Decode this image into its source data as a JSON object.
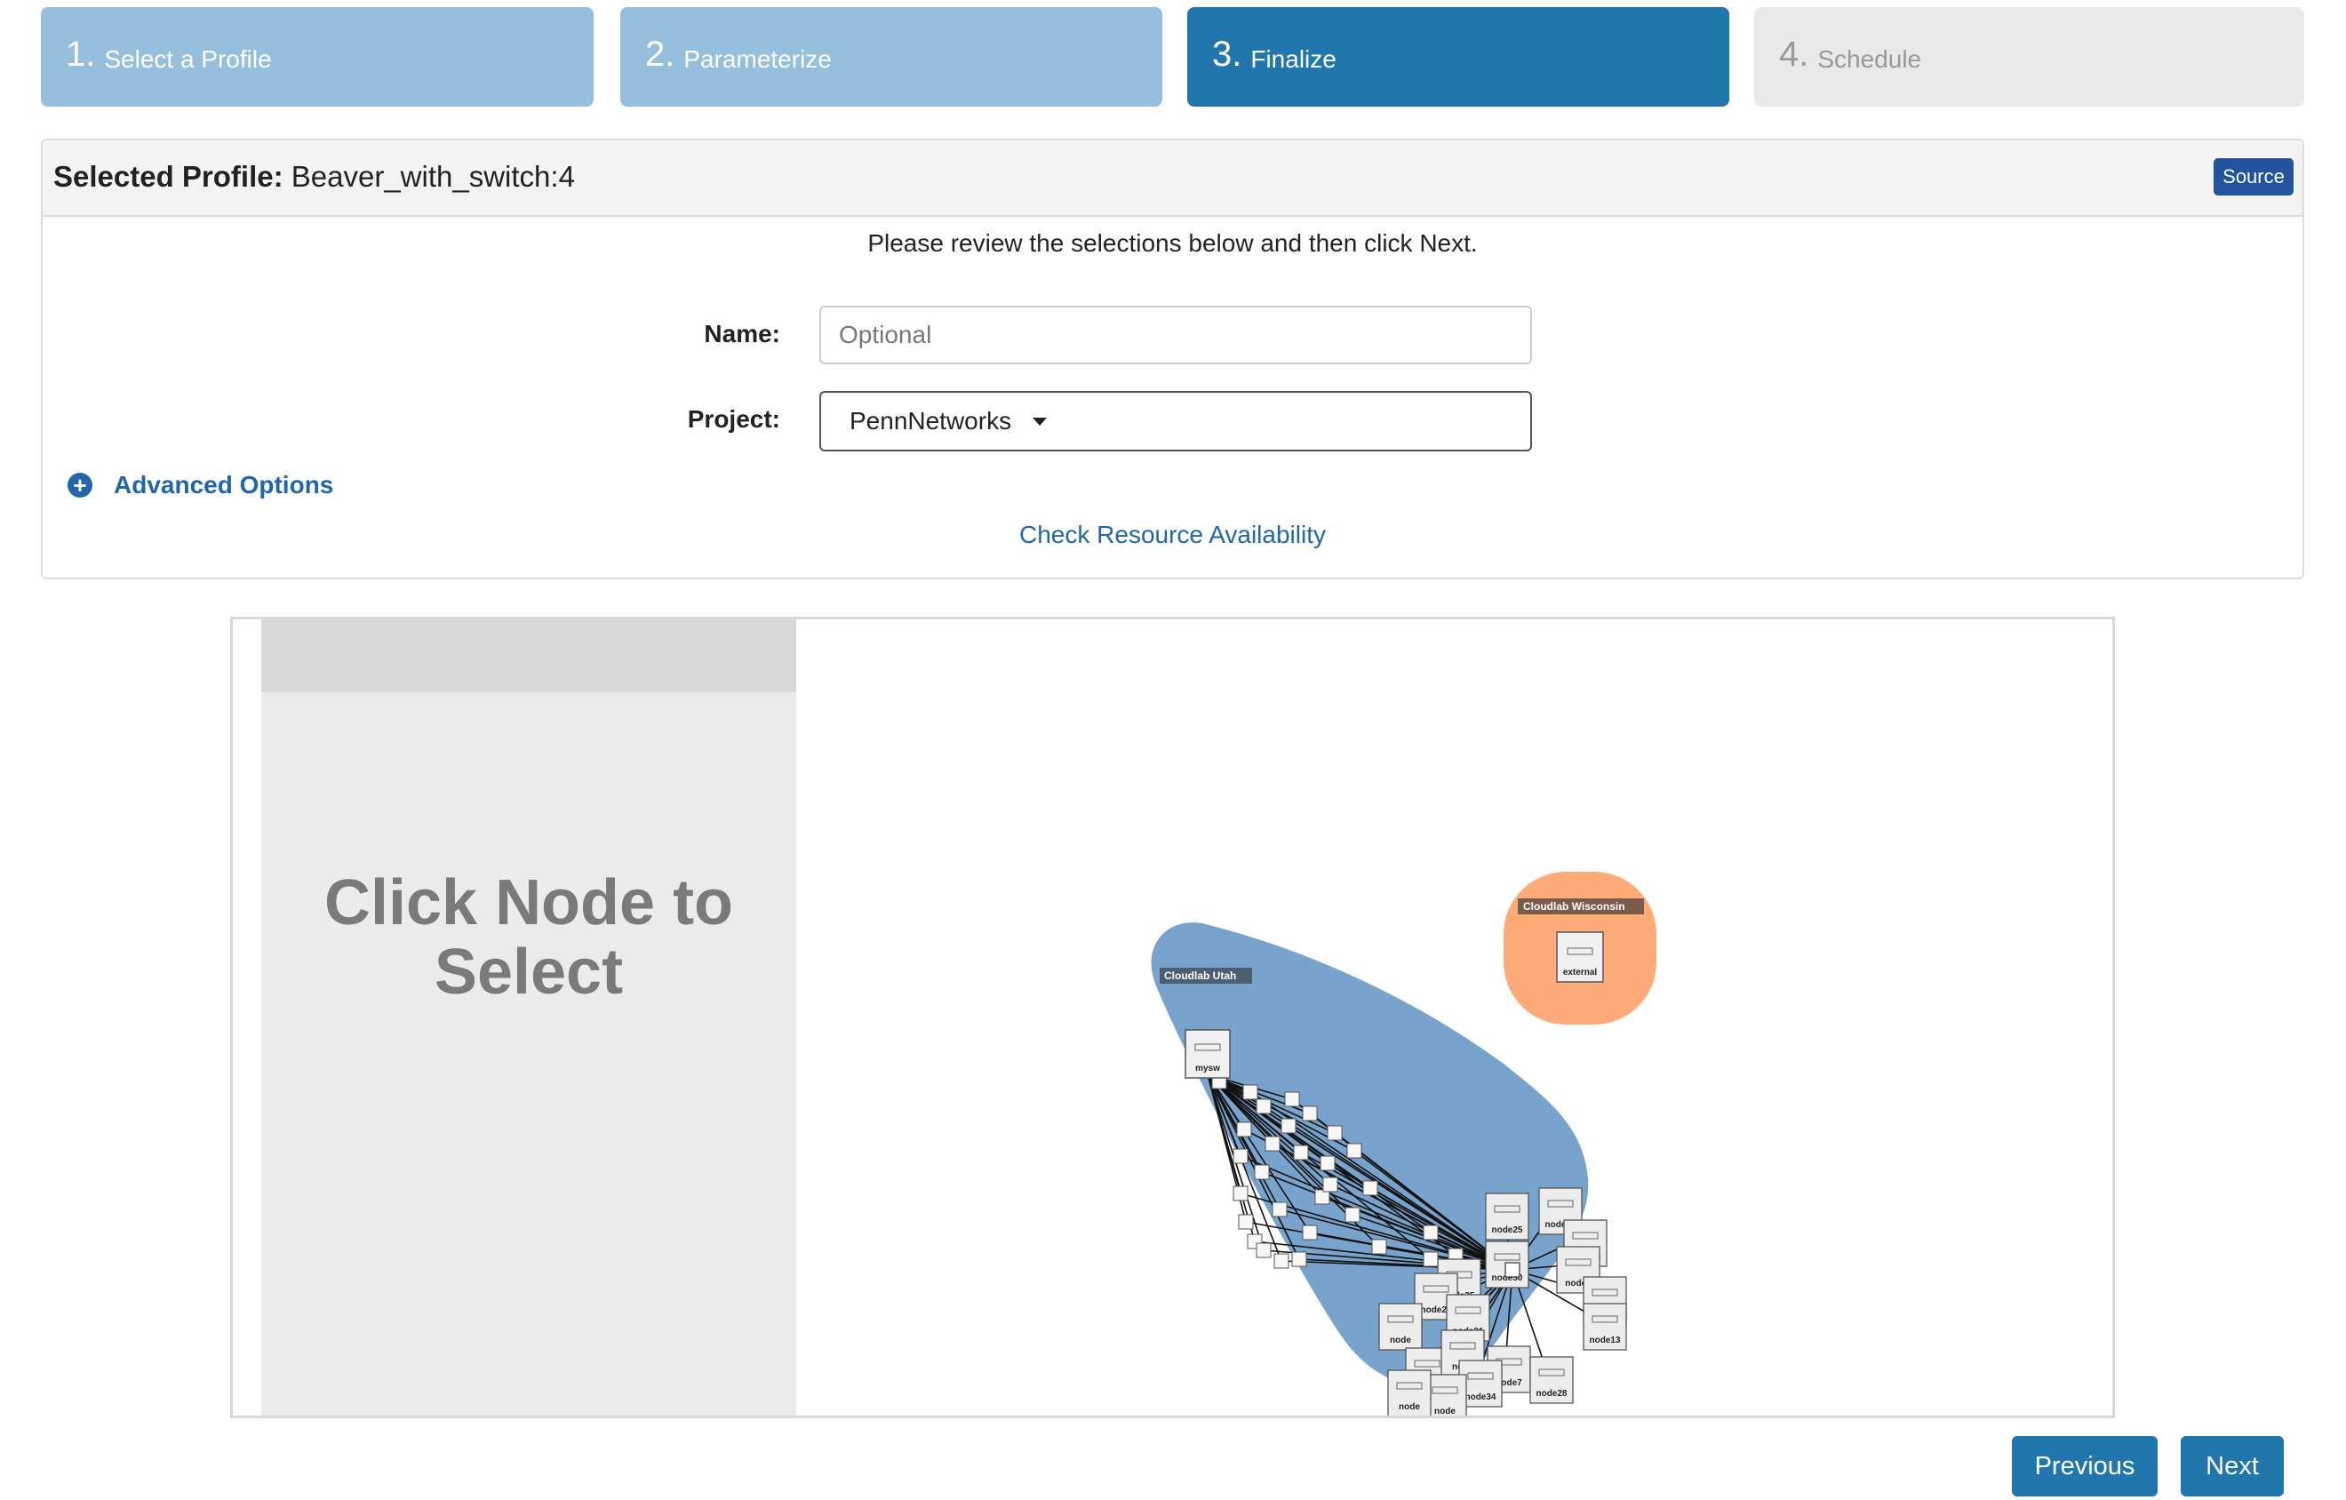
{
  "wizard": {
    "steps": [
      {
        "num": "1.",
        "label": "Select a Profile",
        "state": "done"
      },
      {
        "num": "2.",
        "label": "Parameterize",
        "state": "done"
      },
      {
        "num": "3.",
        "label": "Finalize",
        "state": "active"
      },
      {
        "num": "4.",
        "label": "Schedule",
        "state": "todo"
      }
    ]
  },
  "profile": {
    "title_prefix": "Selected Profile:",
    "name": "Beaver_with_switch:4",
    "source_label": "Source"
  },
  "form": {
    "instruction": "Please review the selections below and then click Next.",
    "name_label": "Name:",
    "name_placeholder": "Optional",
    "name_value": "",
    "project_label": "Project:",
    "project_value": "PennNetworks",
    "advanced_label": "Advanced Options",
    "check_label": "Check Resource Availability"
  },
  "topology": {
    "sidebar_message": "Click Node to Select",
    "sites": [
      {
        "label": "Cloudlab Utah",
        "color": "#77a3cc"
      },
      {
        "label": "Cloudlab Wisconsin",
        "color": "#fdab79"
      }
    ],
    "nodes": [
      "mysw",
      "external",
      "node25",
      "node32",
      "node1",
      "node33",
      "node20",
      "node13",
      "node35",
      "node30",
      "node23",
      "node21",
      "node22",
      "node34",
      "node7",
      "node28"
    ]
  },
  "nav": {
    "previous_label": "Previous",
    "next_label": "Next"
  }
}
